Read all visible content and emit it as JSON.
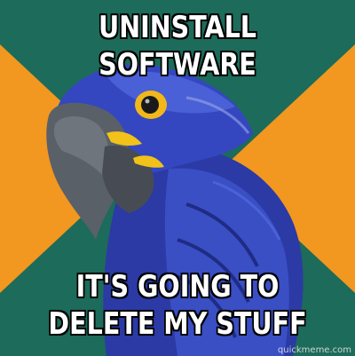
{
  "meme": {
    "top_text": "UNINSTALL SOFTWARE",
    "bottom_text": "IT'S GOING TO DELETE MY STUFF",
    "watermark": "quickmeme.com"
  },
  "colors": {
    "background_teal": "#1d6b5a",
    "background_orange": "#f2971f",
    "parrot_blue": "#2f3fb0",
    "caption_text": "#ffffff"
  }
}
